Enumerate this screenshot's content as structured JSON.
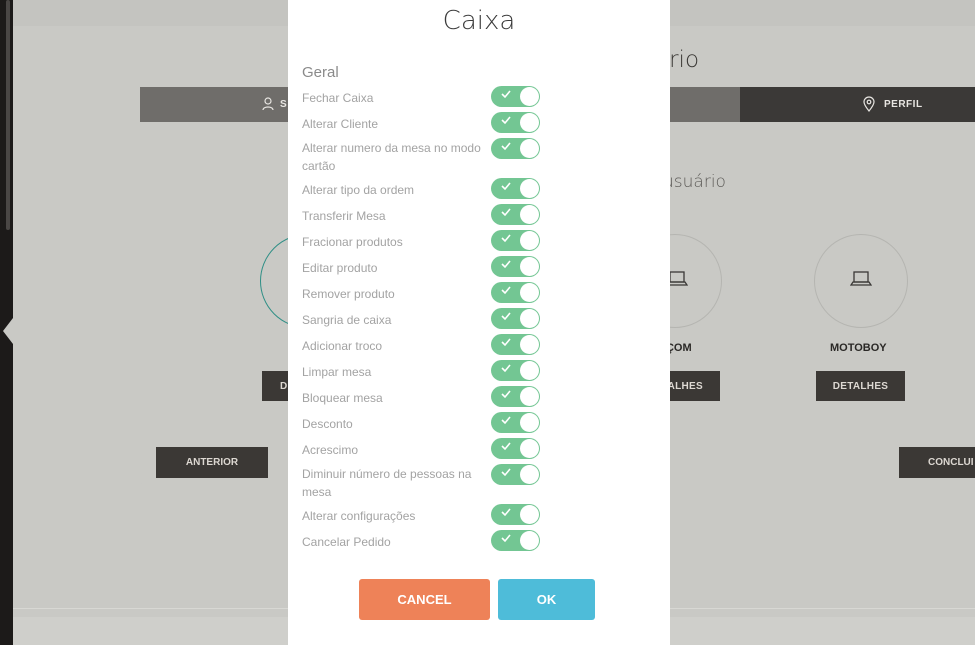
{
  "background": {
    "card_title": "ario",
    "tab_left_label": "S",
    "tab_perfil_label": "PERFIL",
    "subtitle": "usuário",
    "role_mid": "RÇOM",
    "role_right": "MOTOBOY",
    "detail_left": "D",
    "detail_mid": "ALHES",
    "detail_right": "DETALHES",
    "anterior": "ANTERIOR",
    "concluir": "CONCLUI"
  },
  "modal": {
    "title": "Caixa",
    "group": "Geral",
    "permissions": [
      {
        "label": "Fechar Caixa",
        "enabled": true
      },
      {
        "label": "Alterar Cliente",
        "enabled": true
      },
      {
        "label": "Alterar numero da mesa no modo cartão",
        "enabled": true
      },
      {
        "label": "Alterar tipo da ordem",
        "enabled": true
      },
      {
        "label": "Transferir Mesa",
        "enabled": true
      },
      {
        "label": "Fracionar produtos",
        "enabled": true
      },
      {
        "label": "Editar produto",
        "enabled": true
      },
      {
        "label": "Remover produto",
        "enabled": true
      },
      {
        "label": "Sangria de caixa",
        "enabled": true
      },
      {
        "label": "Adicionar troco",
        "enabled": true
      },
      {
        "label": "Limpar mesa",
        "enabled": true
      },
      {
        "label": "Bloquear mesa",
        "enabled": true
      },
      {
        "label": "Desconto",
        "enabled": true
      },
      {
        "label": "Acrescimo",
        "enabled": true
      },
      {
        "label": "Diminuir número de pessoas na mesa",
        "enabled": true
      },
      {
        "label": "Alterar configurações",
        "enabled": true
      },
      {
        "label": "Cancelar Pedido",
        "enabled": true
      }
    ],
    "cancel_label": "CANCEL",
    "ok_label": "OK"
  },
  "colors": {
    "toggle_on": "#73c693",
    "cancel": "#ee8258",
    "ok": "#4ebcd9"
  }
}
